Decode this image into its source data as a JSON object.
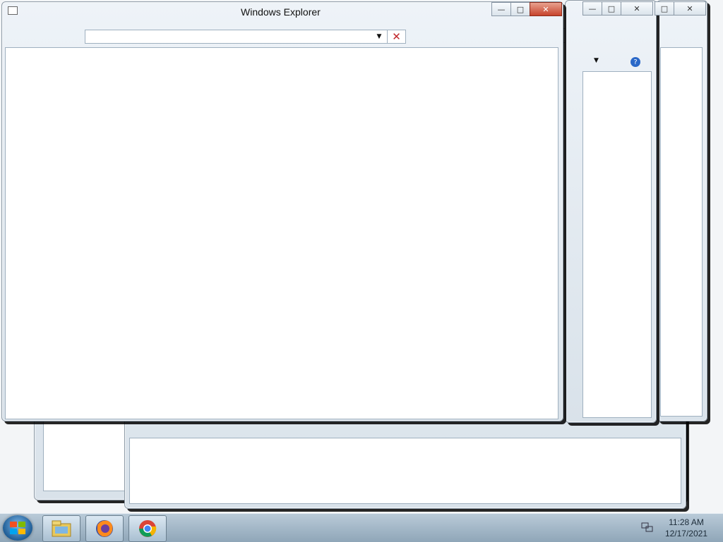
{
  "window": {
    "title": "Windows Explorer",
    "address_value": "",
    "minimize_glyph": "—",
    "maximize_glyph": "□",
    "close_glyph": "✕",
    "addr_dropdown_glyph": "▼",
    "addr_close_glyph": "✕"
  },
  "taskbar": {
    "items": [
      {
        "name": "windows-explorer-button"
      },
      {
        "name": "firefox-button"
      },
      {
        "name": "chrome-button"
      }
    ],
    "clock_time": "11:28 AM",
    "clock_date": "12/17/2021"
  },
  "colors": {
    "close_red": "#c6432c",
    "address_close": "#c0262b",
    "help_blue": "#2a68c8"
  }
}
